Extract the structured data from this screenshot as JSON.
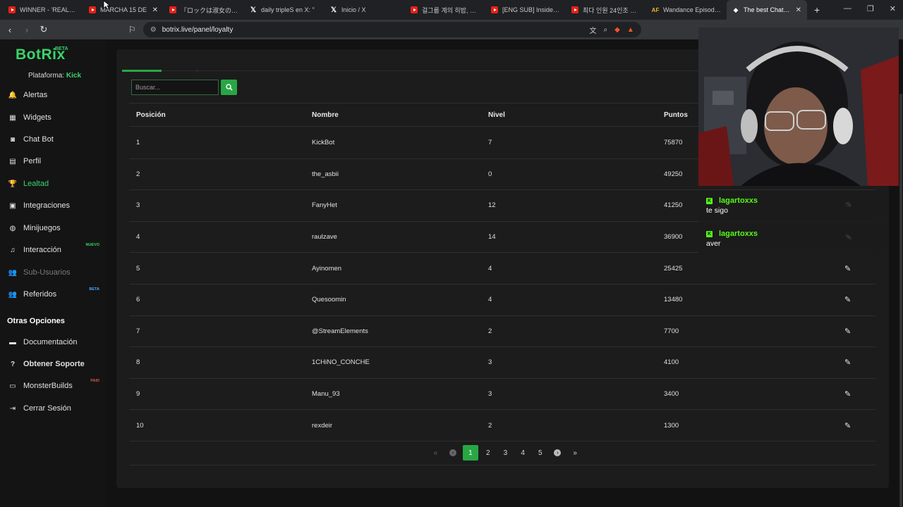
{
  "browser": {
    "tabs": [
      {
        "icon": "youtube-icon",
        "title": "WINNER - 'REALLY REA",
        "active": false
      },
      {
        "icon": "youtube-icon",
        "title": "MARCHA 15 DE",
        "active": false,
        "close": "✕"
      },
      {
        "icon": "youtube-icon",
        "title": "『ロックは淑女の嗜みでし",
        "active": false
      },
      {
        "icon": "x-icon",
        "title": "daily tripleS en X: \"",
        "active": false
      },
      {
        "icon": "x-icon",
        "title": "Inicio / X",
        "active": false
      },
      {
        "icon": "youtube-icon",
        "title": "걸그룹 계의 히밥, 쯔양",
        "active": false
      },
      {
        "icon": "youtube-icon",
        "title": "[ENG SUB] Inside the N",
        "active": false
      },
      {
        "icon": "youtube-icon",
        "title": "최다 인원 24인조 아이",
        "active": false
      },
      {
        "icon": "animeflv-icon",
        "title": "Wandance Episodio 2",
        "active": false
      },
      {
        "icon": "botrix-icon",
        "title": "The best ChatBot",
        "active": true,
        "close": "✕"
      }
    ],
    "url": "botrix.live/panel/loyalty"
  },
  "sidebar": {
    "logo": "BotRix",
    "logo_badge": "BETA",
    "platform_label": "Plataforma:",
    "platform_value": "Kick",
    "items": [
      {
        "label": "Alertas",
        "icon": "bell-icon",
        "glyph": "🔔",
        "state": "normal",
        "badge": ""
      },
      {
        "label": "Widgets",
        "icon": "grid-icon",
        "glyph": "▦",
        "state": "normal",
        "badge": ""
      },
      {
        "label": "Chat Bot",
        "icon": "robot-icon",
        "glyph": "◙",
        "state": "normal",
        "badge": ""
      },
      {
        "label": "Perfil",
        "icon": "id-card-icon",
        "glyph": "▤",
        "state": "normal",
        "badge": ""
      },
      {
        "label": "Lealtad",
        "icon": "trophy-icon",
        "glyph": "🏆",
        "state": "active",
        "badge": ""
      },
      {
        "label": "Integraciones",
        "icon": "puzzle-icon",
        "glyph": "▣",
        "state": "normal",
        "badge": ""
      },
      {
        "label": "Minijuegos",
        "icon": "gamepad-icon",
        "glyph": "◍",
        "state": "normal",
        "badge": ""
      },
      {
        "label": "Interacción",
        "icon": "music-icon",
        "glyph": "♫",
        "state": "normal",
        "badge": "NUEVO"
      },
      {
        "label": "Sub-Usuarios",
        "icon": "users-icon",
        "glyph": "👥",
        "state": "disabled",
        "badge": ""
      },
      {
        "label": "Referidos",
        "icon": "user-plus-icon",
        "glyph": "👥",
        "state": "normal",
        "badge": "BETA"
      }
    ],
    "other_title": "Otras Opciones",
    "other_items": [
      {
        "label": "Documentación",
        "icon": "book-icon",
        "glyph": "▬",
        "badge": ""
      },
      {
        "label": "Obtener Soporte",
        "icon": "help-icon",
        "glyph": "?",
        "badge": ""
      },
      {
        "label": "MonsterBuilds",
        "icon": "monitor-icon",
        "glyph": "▭",
        "badge": "PAID"
      },
      {
        "label": "Cerrar Sesión",
        "icon": "logout-icon",
        "glyph": "⇥",
        "badge": ""
      }
    ]
  },
  "search": {
    "placeholder": "Buscar..."
  },
  "table": {
    "headers": {
      "pos": "Posición",
      "name": "Nombre",
      "level": "Nivel",
      "points": "Puntos"
    },
    "rows": [
      {
        "pos": "1",
        "name": "KickBot",
        "level": "7",
        "points": "75870"
      },
      {
        "pos": "2",
        "name": "the_asbii",
        "level": "0",
        "points": "49250"
      },
      {
        "pos": "3",
        "name": "FanyHet",
        "level": "12",
        "points": "41250"
      },
      {
        "pos": "4",
        "name": "raulzave",
        "level": "14",
        "points": "36900"
      },
      {
        "pos": "5",
        "name": "Ayinomen",
        "level": "4",
        "points": "25425"
      },
      {
        "pos": "6",
        "name": "Quesoomin",
        "level": "4",
        "points": "13480"
      },
      {
        "pos": "7",
        "name": "@StreamElements",
        "level": "2",
        "points": "7700"
      },
      {
        "pos": "8",
        "name": "1CHiNO_CONCHE",
        "level": "3",
        "points": "4100"
      },
      {
        "pos": "9",
        "name": "Manu_93",
        "level": "3",
        "points": "3400"
      },
      {
        "pos": "10",
        "name": "rexdeir",
        "level": "2",
        "points": "1300"
      }
    ]
  },
  "pagination": {
    "first": "«",
    "prev": "‹",
    "pages": [
      "1",
      "2",
      "3",
      "4",
      "5"
    ],
    "current": "1",
    "next": "›",
    "last": "»"
  },
  "chat": [
    {
      "user": "lagartoxxs",
      "text": "te sigo"
    },
    {
      "user": "lagartoxxs",
      "text": "aver"
    }
  ],
  "colors": {
    "accent": "#28a745",
    "brand": "#3ad46a",
    "kick": "#53fc18"
  }
}
